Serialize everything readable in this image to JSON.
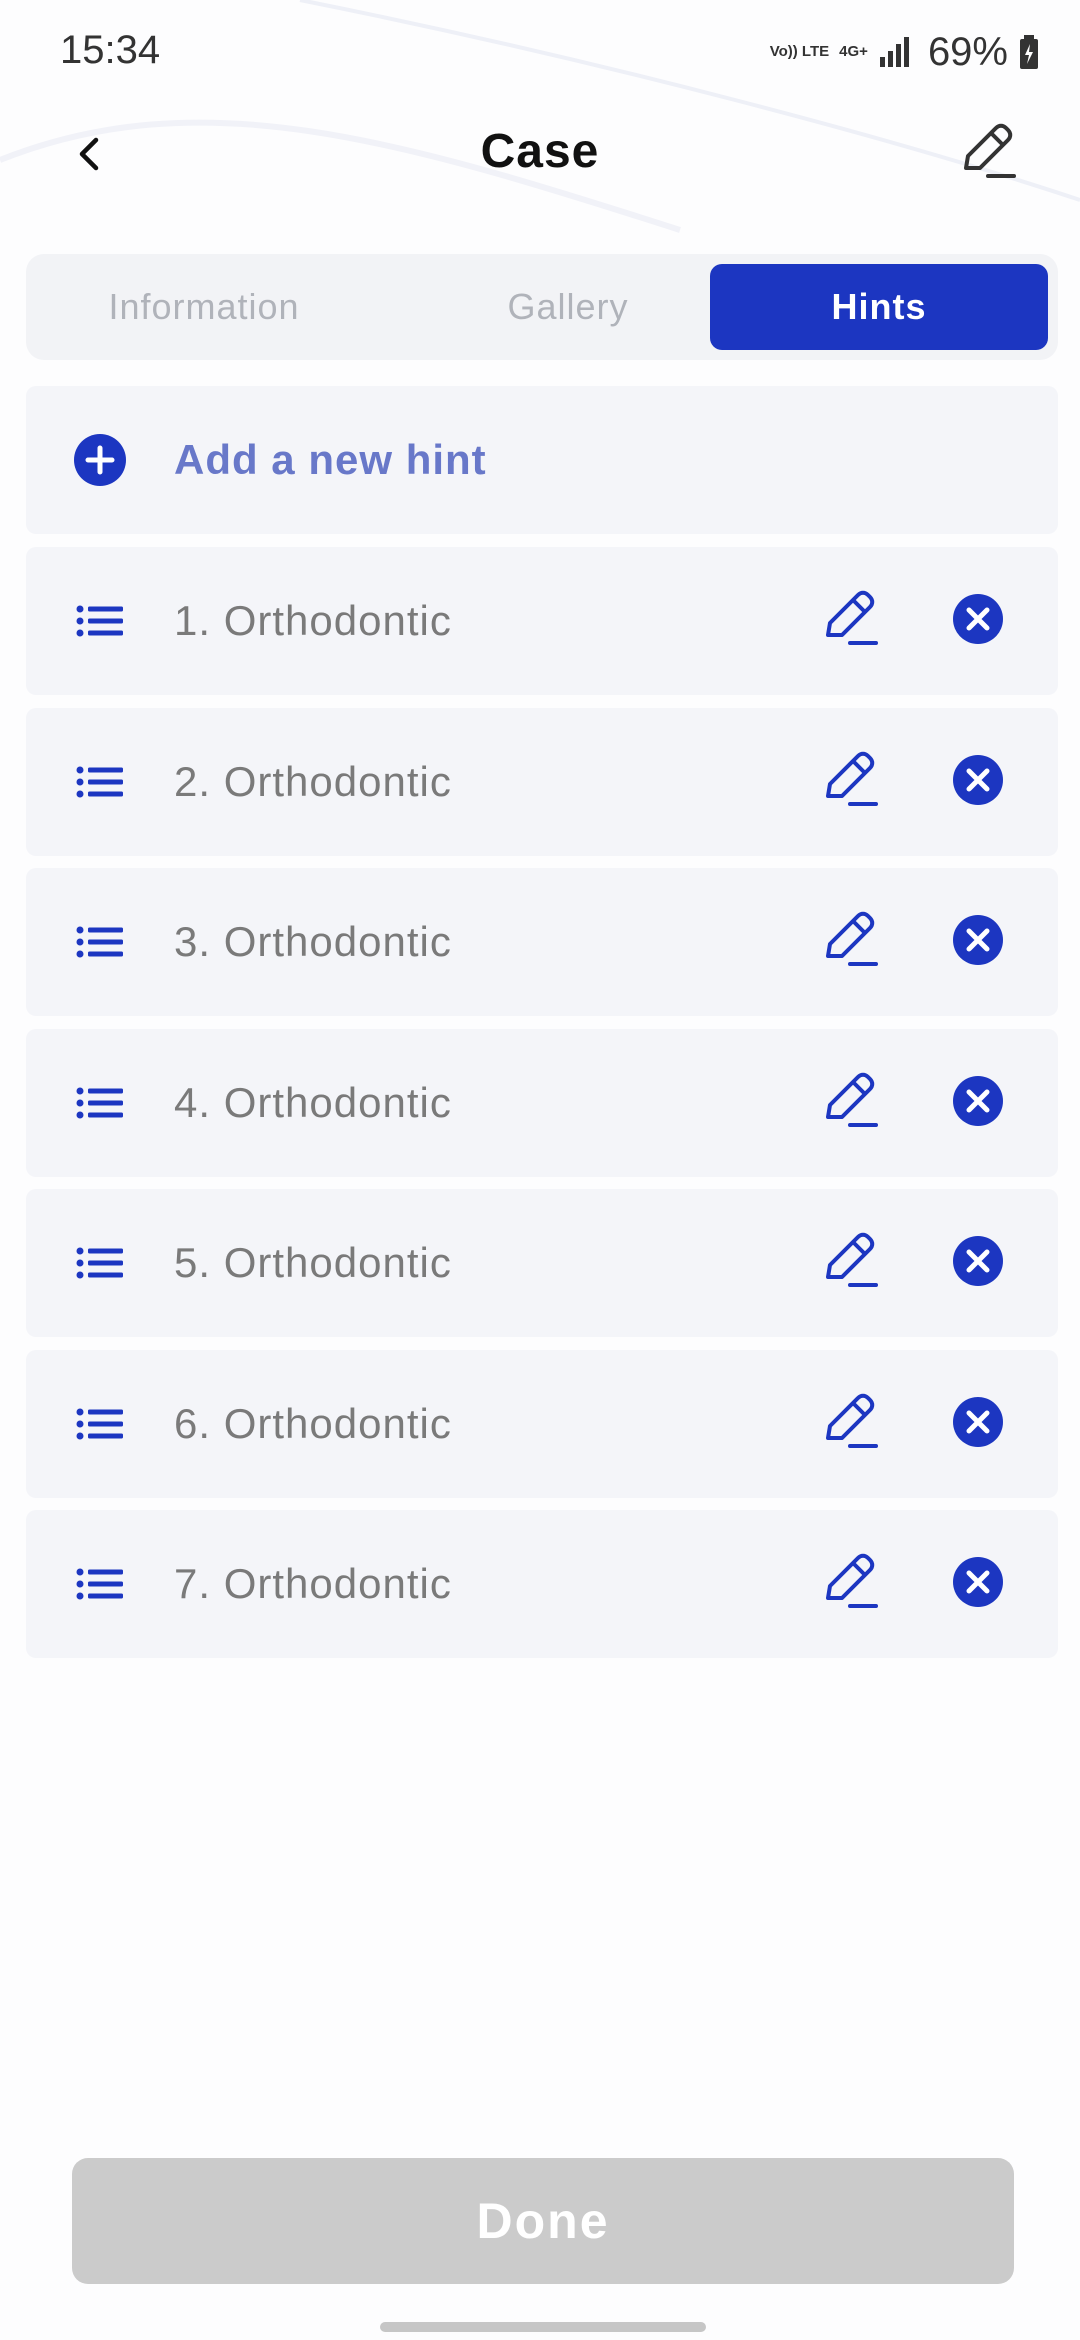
{
  "status_bar": {
    "time": "15:34",
    "network_volte": "Vo)) LTE",
    "network_type": "4G+",
    "battery": "69%",
    "icons": [
      "signal-bars-icon",
      "battery-charging-icon"
    ]
  },
  "header": {
    "title": "Case",
    "back_icon": "chevron-left-icon",
    "edit_icon": "pencil-icon"
  },
  "tabs": [
    {
      "label": "Information",
      "selected": false
    },
    {
      "label": "Gallery",
      "selected": false
    },
    {
      "label": "Hints",
      "selected": true
    }
  ],
  "add_hint": {
    "label": "Add a new hint",
    "icon": "plus-circle-icon"
  },
  "hints": [
    {
      "label": "1. Orthodontic"
    },
    {
      "label": "2. Orthodontic"
    },
    {
      "label": "3. Orthodontic"
    },
    {
      "label": "4. Orthodontic"
    },
    {
      "label": "5. Orthodontic"
    },
    {
      "label": "6. Orthodontic"
    },
    {
      "label": "7. Orthodontic"
    }
  ],
  "hint_icons": {
    "drag": "list-icon",
    "edit": "pencil-icon",
    "delete": "close-circle-icon"
  },
  "footer": {
    "done_label": "Done"
  },
  "colors": {
    "accent": "#1c36c1",
    "add_label": "#6878c9",
    "card_bg": "#f4f5f9",
    "done_disabled": "#cbcbcb"
  }
}
